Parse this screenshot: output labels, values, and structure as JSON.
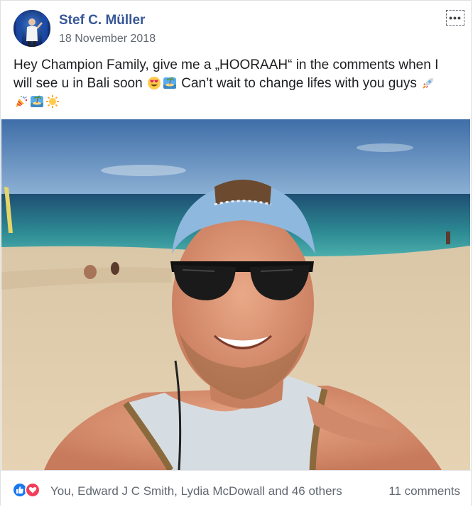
{
  "post": {
    "author": "Stef C. Müller",
    "date": "18 November 2018",
    "text_line1": "Hey Champion Family, give me a „HOORAAH“ in the comments when I",
    "text_line2a": "will see u in Bali soon ",
    "text_line2b": " Can’t wait to change lifes with you guys ",
    "emojis": [
      "heart-eyes-icon",
      "beach-island-icon",
      "rocket-icon",
      "party-popper-icon",
      "beach-island-icon",
      "sun-icon"
    ]
  },
  "footer": {
    "reactions": [
      "like-icon",
      "love-icon"
    ],
    "reaction_names": "You, Edward J C Smith, Lydia McDowall and 46 others",
    "comments": "11 comments"
  },
  "colors": {
    "author_link": "#385898",
    "secondary_text": "#606770",
    "like_blue": "#1877f2",
    "love_red": "#f33e58"
  }
}
